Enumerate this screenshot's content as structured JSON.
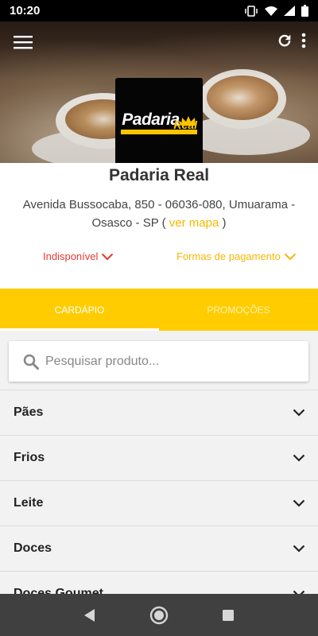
{
  "status": {
    "time": "10:20"
  },
  "store": {
    "name": "Padaria Real",
    "address": "Avenida Bussocaba, 850 - 06036-080, Umuarama - Osasco - SP",
    "map_open": "(",
    "map_link": "ver mapa",
    "map_close": ")",
    "logo_top": "Padaria",
    "logo_bottom": "Real"
  },
  "options": {
    "unavailable": "Indisponível",
    "payment": "Formas de pagamento"
  },
  "tabs": [
    {
      "label": "CARDÁPIO",
      "active": true
    },
    {
      "label": "PROMOÇÕES",
      "active": false
    }
  ],
  "search": {
    "placeholder": "Pesquisar produto..."
  },
  "categories": [
    {
      "label": "Pães"
    },
    {
      "label": "Frios"
    },
    {
      "label": "Leite"
    },
    {
      "label": "Doces"
    },
    {
      "label": "Doces Goumet"
    }
  ],
  "colors": {
    "accent": "#ffcc00",
    "unavailable": "#e53935",
    "link": "#f5b800"
  },
  "icons": [
    "menu-icon",
    "refresh-icon",
    "more-vert-icon",
    "search-icon",
    "chevron-down-icon",
    "back-icon",
    "home-icon",
    "recents-icon"
  ]
}
